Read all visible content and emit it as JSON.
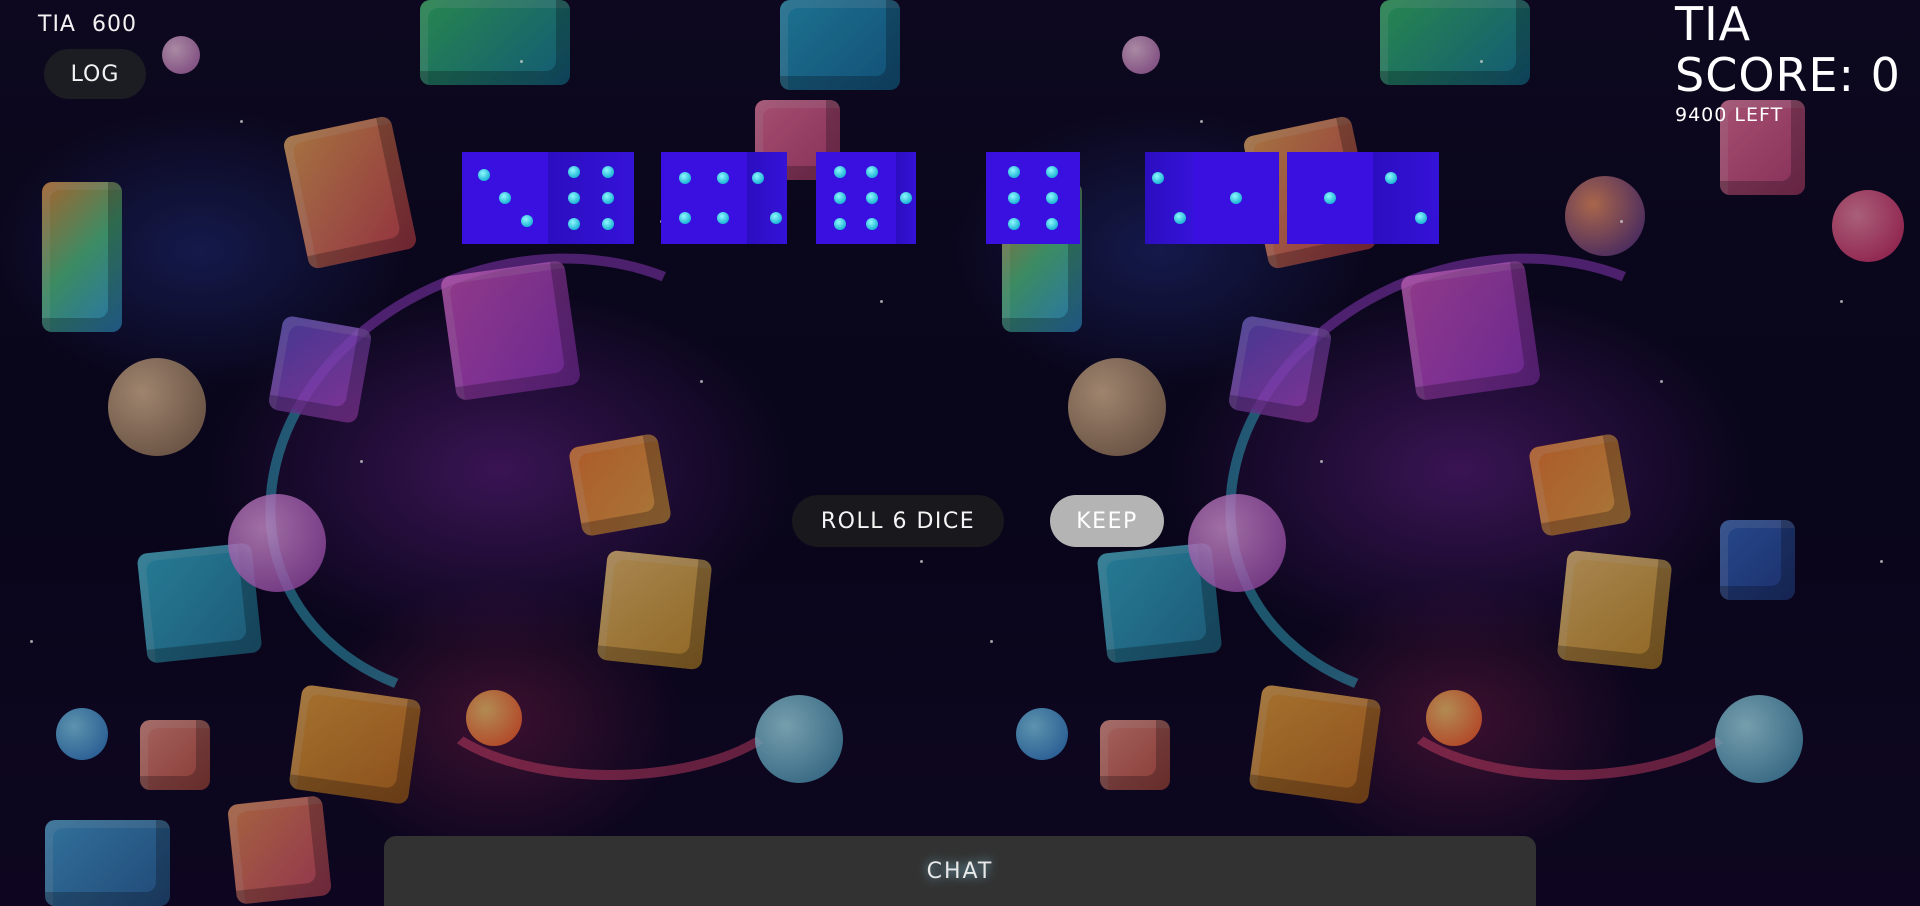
{
  "hud": {
    "player_name": "TIA",
    "player_points": "600",
    "log_label": "LOG"
  },
  "scoreboard": {
    "player_name": "TIA",
    "score_label": "SCORE: 0",
    "remaining_label": "9400 LEFT"
  },
  "dice": [
    {
      "front_pips": 3,
      "side_pips": 6
    },
    {
      "front_pips": 4,
      "side_pips": 2
    },
    {
      "front_pips": 6,
      "side_pips": 1
    },
    {
      "front_pips": 6,
      "side_pips": 0
    },
    {
      "front_pips": 1,
      "side_pips": 2
    },
    {
      "front_pips": 1,
      "side_pips": 2
    }
  ],
  "actions": {
    "roll_label": "ROLL 6 DICE",
    "keep_label": "KEEP"
  },
  "chat": {
    "label": "CHAT"
  },
  "colors": {
    "die_face": "#3a10e0",
    "pip": "#2fd0e6",
    "keep_disabled": "#b4b4b4",
    "chat_bar": "#323232"
  }
}
